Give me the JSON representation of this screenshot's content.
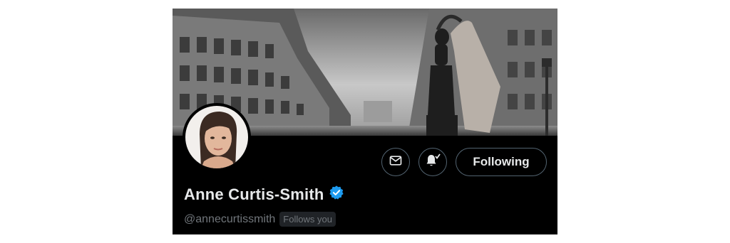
{
  "profile": {
    "display_name": "Anne Curtis-Smith",
    "handle": "@annecurtissmith",
    "follows_you": "Follows you",
    "verified": true,
    "verified_color": "#1d9bf0"
  },
  "actions": {
    "message_icon": "envelope-icon",
    "notify_icon": "bell-check-icon",
    "following_label": "Following"
  },
  "theme": {
    "background": "#000000",
    "text_primary": "#e7e9ea",
    "text_secondary": "#71767b",
    "border": "#536471"
  }
}
